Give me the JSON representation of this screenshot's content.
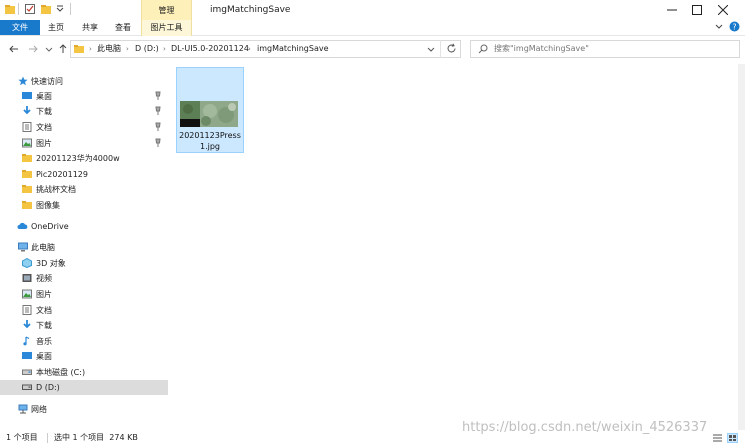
{
  "window": {
    "title": "imgMatchingSave",
    "context_tab": "管理"
  },
  "ribbon": {
    "tabs": [
      "文件",
      "主页",
      "共享",
      "查看",
      "图片工具"
    ]
  },
  "nav": {
    "breadcrumb": [
      "此电脑",
      "D (D:)",
      "DL-UI5.0-20201124",
      "imgMatchingSave"
    ]
  },
  "search": {
    "placeholder": "搜索\"imgMatchingSave\""
  },
  "sidebar": {
    "items": [
      {
        "label": "快速访问",
        "icon": "star-icon"
      },
      {
        "label": "桌面",
        "icon": "desktop-icon",
        "pinned": true
      },
      {
        "label": "下载",
        "icon": "download-icon",
        "pinned": true
      },
      {
        "label": "文档",
        "icon": "document-icon",
        "pinned": true
      },
      {
        "label": "图片",
        "icon": "pictures-icon",
        "pinned": true
      },
      {
        "label": "20201123华为4000w",
        "icon": "folder-icon"
      },
      {
        "label": "Pic20201129",
        "icon": "folder-icon"
      },
      {
        "label": "挑战杯文档",
        "icon": "folder-icon"
      },
      {
        "label": "图像集",
        "icon": "folder-icon"
      },
      {
        "label": "OneDrive",
        "icon": "cloud-icon"
      },
      {
        "label": "此电脑",
        "icon": "computer-icon"
      },
      {
        "label": "3D 对象",
        "icon": "3d-objects-icon"
      },
      {
        "label": "视频",
        "icon": "video-icon"
      },
      {
        "label": "图片",
        "icon": "pictures-icon"
      },
      {
        "label": "文档",
        "icon": "document-icon"
      },
      {
        "label": "下载",
        "icon": "download-icon"
      },
      {
        "label": "音乐",
        "icon": "music-icon"
      },
      {
        "label": "桌面",
        "icon": "desktop-icon"
      },
      {
        "label": "本地磁盘 (C:)",
        "icon": "drive-icon"
      },
      {
        "label": "D (D:)",
        "icon": "drive-icon",
        "selected": true
      },
      {
        "label": "网络",
        "icon": "network-icon"
      }
    ]
  },
  "content": {
    "file": {
      "name": "20201123Press1.jpg",
      "name_line1": "20201123Press",
      "name_line2": "1.jpg"
    }
  },
  "status": {
    "count": "1 个项目",
    "selection": "选中 1 个项目  274 KB"
  },
  "watermark": "https://blog.csdn.net/weixin_4526337",
  "colors": {
    "accent": "#1979ca",
    "selected_tile": "#cce8ff",
    "folder": "#f4c542"
  }
}
